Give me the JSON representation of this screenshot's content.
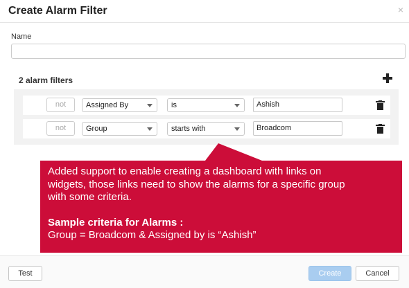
{
  "dialog": {
    "title": "Create Alarm Filter",
    "close_glyph": "×"
  },
  "name_field": {
    "label": "Name",
    "value": "",
    "placeholder": ""
  },
  "filters": {
    "heading": "2 alarm filters",
    "add_icon": "plus-icon",
    "rows": [
      {
        "not_label": "not",
        "field": "Assigned By",
        "operator": "is",
        "value": "Ashish",
        "delete_icon": "trash-icon"
      },
      {
        "not_label": "not",
        "field": "Group",
        "operator": "starts with",
        "value": "Broadcom",
        "delete_icon": "trash-icon"
      }
    ]
  },
  "annotation": {
    "background_color": "#cc0d39",
    "lines": [
      "Added support to enable creating a dashboard with links on",
      "widgets, those links need to show the alarms for a specific group",
      "with some criteria."
    ],
    "heading": "Sample criteria for Alarms :",
    "example": "Group = Broadcom & Assigned by is “Ashish”"
  },
  "footer": {
    "test_label": "Test",
    "create_label": "Create",
    "cancel_label": "Cancel"
  }
}
